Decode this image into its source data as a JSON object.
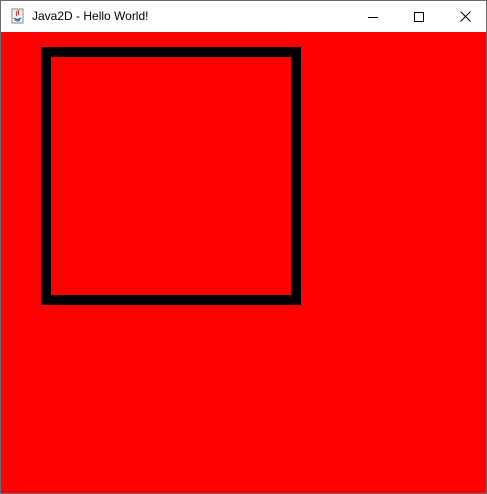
{
  "window": {
    "title": "Java2D - Hello World!",
    "app_icon": "java-icon",
    "controls": {
      "minimize_icon": "minimize-icon",
      "maximize_icon": "maximize-icon",
      "close_icon": "close-icon"
    }
  },
  "canvas": {
    "background_color": "#ff0000",
    "shape": {
      "type": "rectangle-outline",
      "stroke_color": "#000000",
      "fill": "none"
    }
  },
  "colors": {
    "titlebar": "#ffffff",
    "canvas": "#ff0000",
    "stroke": "#000000"
  }
}
